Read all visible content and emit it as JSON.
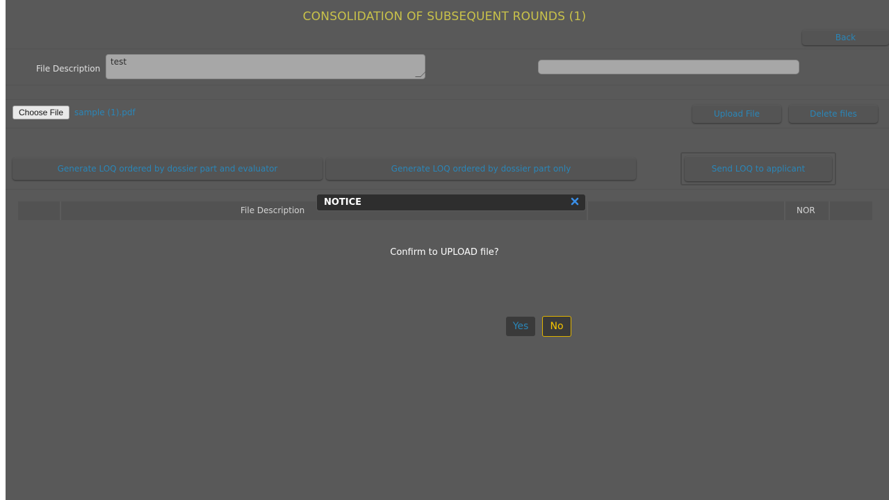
{
  "header": {
    "title": "CONSOLIDATION OF SUBSEQUENT ROUNDS (1)",
    "back_label": "Back"
  },
  "form": {
    "file_description_label": "File Description",
    "file_description_value": "test",
    "choose_file_label": "Choose File",
    "selected_file": "sample (1).pdf",
    "upload_label": "Upload File",
    "delete_label": "Delete files"
  },
  "actions": {
    "generate_by_part_and_evaluator": "Generate LOQ ordered by dossier part and evaluator",
    "generate_by_part_only": "Generate LOQ ordered by dossier part only",
    "send_loq": "Send LOQ to applicant"
  },
  "table": {
    "columns": [
      "",
      "File Description",
      "",
      "NOR",
      ""
    ]
  },
  "dialog": {
    "title": "NOTICE",
    "message": "Confirm to UPLOAD file?",
    "yes_label": "Yes",
    "no_label": "No",
    "close_icon": "close-icon"
  },
  "colors": {
    "background": "#595959",
    "title": "#c9c24a",
    "link_blue": "#2a86b8",
    "no_accent": "#f5c400"
  }
}
